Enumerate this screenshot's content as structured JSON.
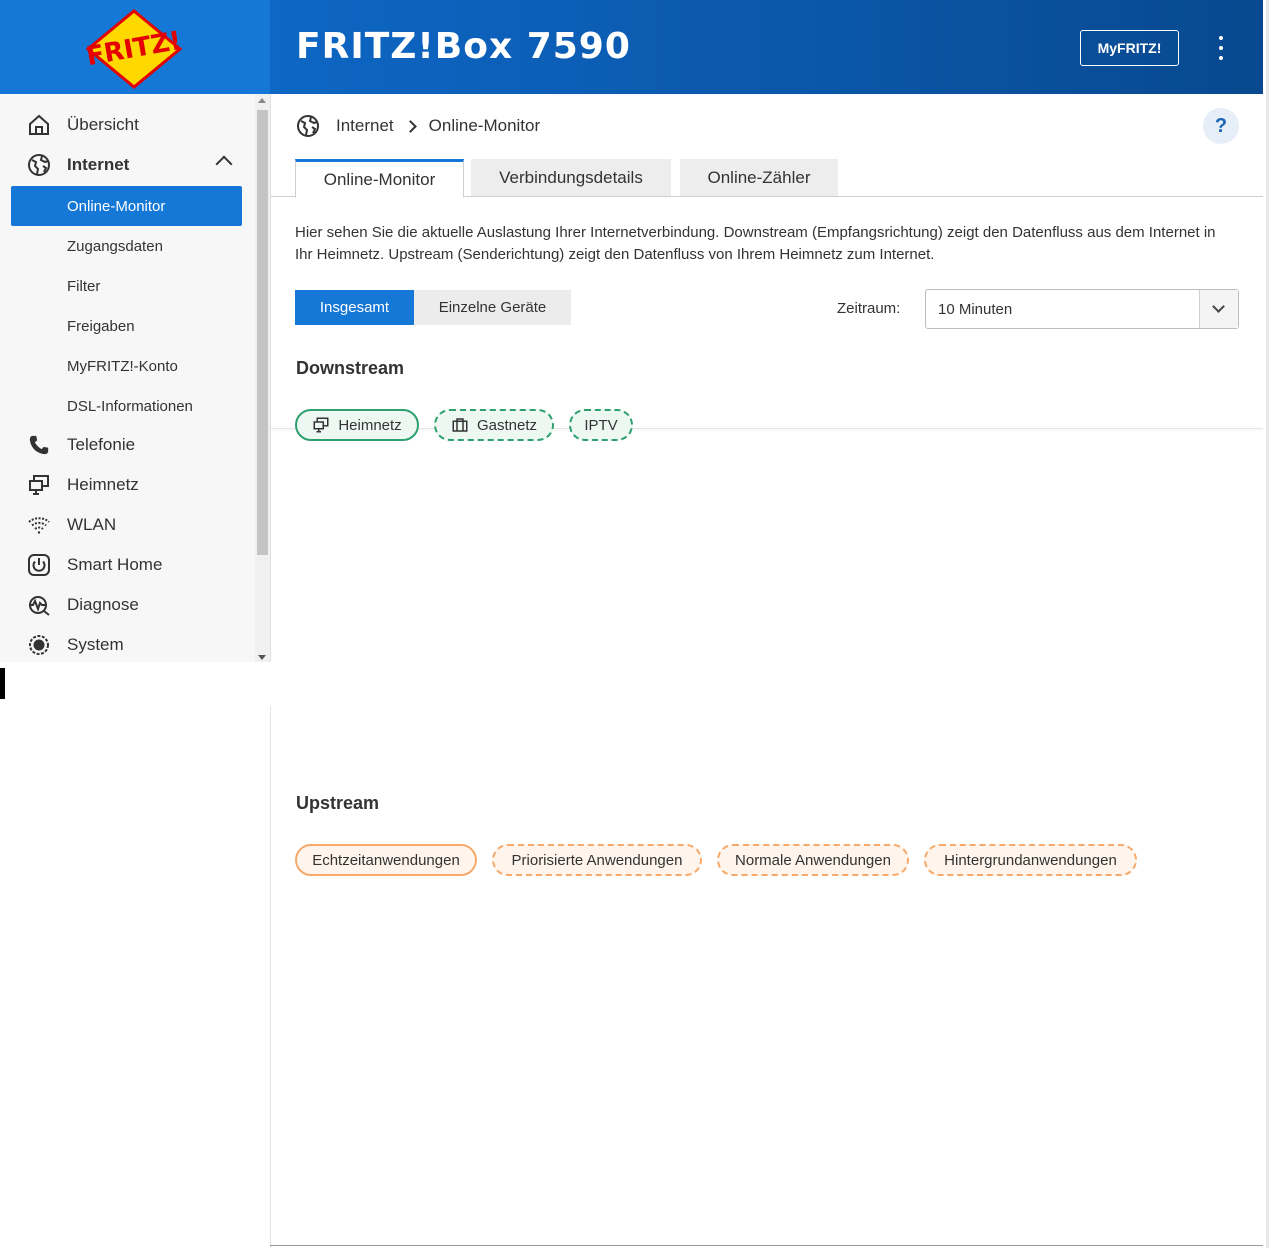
{
  "header": {
    "logo_text": "FRITZ!",
    "product_title": "FRITZ!Box 7590",
    "myfritz_label": "MyFRITZ!",
    "menu_icon": "kebab-menu-icon"
  },
  "sidebar": {
    "items": [
      {
        "label": "Übersicht",
        "icon": "home-icon"
      },
      {
        "label": "Internet",
        "icon": "globe-icon"
      },
      {
        "label": "Telefonie",
        "icon": "phone-icon"
      },
      {
        "label": "Heimnetz",
        "icon": "monitor-icon"
      },
      {
        "label": "WLAN",
        "icon": "wifi-icon"
      },
      {
        "label": "Smart Home",
        "icon": "power-icon"
      },
      {
        "label": "Diagnose",
        "icon": "diagnose-icon"
      },
      {
        "label": "System",
        "icon": "gear-icon"
      }
    ],
    "internet_sub": [
      {
        "label": "Online-Monitor",
        "active": true
      },
      {
        "label": "Zugangsdaten"
      },
      {
        "label": "Filter"
      },
      {
        "label": "Freigaben"
      },
      {
        "label": "MyFRITZ!-Konto"
      },
      {
        "label": "DSL-Informationen"
      }
    ]
  },
  "breadcrumb": {
    "root": "Internet",
    "current": "Online-Monitor"
  },
  "help_label": "?",
  "tabs": [
    {
      "label": "Online-Monitor",
      "active": true
    },
    {
      "label": "Verbindungsdetails"
    },
    {
      "label": "Online-Zähler"
    }
  ],
  "description": "Hier sehen Sie die aktuelle Auslastung Ihrer Internetverbindung. Downstream (Empfangsrichtung) zeigt den Datenfluss aus dem Internet in Ihr Heimnetz. Upstream (Senderichtung) zeigt den Datenfluss von Ihrem Heimnetz zum Internet.",
  "view_toggle": {
    "on": "Insgesamt",
    "off": "Einzelne Geräte"
  },
  "zeitraum": {
    "label": "Zeitraum:",
    "value": "10 Minuten"
  },
  "downstream": {
    "title": "Downstream",
    "legend": [
      {
        "label": "Heimnetz",
        "icon": "monitor-icon"
      },
      {
        "label": "Gastnetz",
        "icon": "suitcase-icon"
      },
      {
        "label": "IPTV"
      }
    ]
  },
  "upstream": {
    "title": "Upstream",
    "legend": [
      {
        "label": "Echtzeitanwendungen"
      },
      {
        "label": "Priorisierte Anwendungen"
      },
      {
        "label": "Normale Anwendungen"
      },
      {
        "label": "Hintergrundanwendungen"
      }
    ]
  },
  "colors": {
    "accent": "#1577d6",
    "downstream": "#2ea06e",
    "upstream": "#f6a96a"
  }
}
